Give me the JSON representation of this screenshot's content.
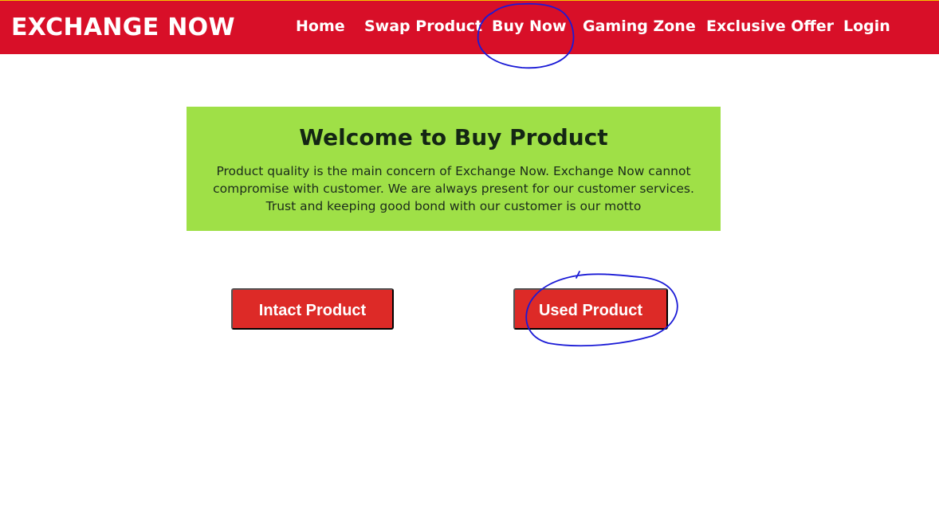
{
  "header": {
    "brand": "EXCHANGE NOW",
    "nav": [
      "Home",
      "Swap Product",
      "Buy Now",
      "Gaming Zone",
      "Exclusive Offer",
      "Login"
    ]
  },
  "hero": {
    "title": "Welcome to Buy Product",
    "description": "Product quality is the main concern of Exchange Now. Exchange Now cannot compromise with customer. We are always present for our customer services. Trust and keeping good bond with our customer is our motto"
  },
  "actions": {
    "intact": "Intact Product",
    "used": "Used Product"
  },
  "colors": {
    "header_bg": "#d80f28",
    "hero_bg": "#9fe047",
    "button_bg": "#dd2a27",
    "annotation_stroke": "#1a1ad6"
  }
}
